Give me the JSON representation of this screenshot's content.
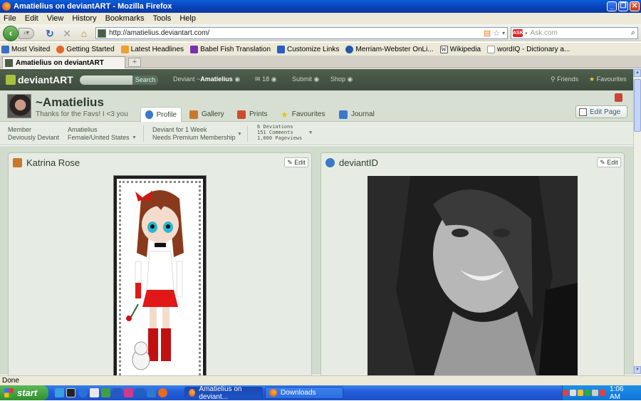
{
  "window": {
    "title": "Amatielius on deviantART - Mozilla Firefox"
  },
  "menu": [
    "File",
    "Edit",
    "View",
    "History",
    "Bookmarks",
    "Tools",
    "Help"
  ],
  "nav": {
    "url": "http://amatielius.deviantart.com/",
    "search_placeholder": "Ask.com"
  },
  "bookmarks": [
    {
      "label": "Most Visited",
      "color": "#3a6fc4"
    },
    {
      "label": "Getting Started",
      "color": "#e2682a"
    },
    {
      "label": "Latest Headlines",
      "color": "#f0a030"
    },
    {
      "label": "Babel Fish Translation",
      "color": "#7a2fb0"
    },
    {
      "label": "Customize Links",
      "color": "#2a5fc0"
    },
    {
      "label": "Merriam-Webster OnLi...",
      "color": "#2458a8"
    },
    {
      "label": "Wikipedia",
      "color": "#555555"
    },
    {
      "label": "wordIQ - Dictionary a...",
      "color": "#cccccc"
    }
  ],
  "tab": {
    "title": "Amatielius on deviantART"
  },
  "da": {
    "logo": "deviantART",
    "search_button": "Search",
    "deviant_prefix": "Deviant ~",
    "deviant_name": "Amatielius",
    "messages": "18",
    "submit": "Submit",
    "shop": "Shop",
    "friends": "Friends",
    "favourites": "Favourites"
  },
  "profile": {
    "username": "~Amatielius",
    "tagline": "Thanks for the Favs! I <3 you",
    "tabs": [
      {
        "label": "Profile",
        "color": "#3a78c9",
        "active": true
      },
      {
        "label": "Gallery",
        "color": "#c9782a",
        "active": false
      },
      {
        "label": "Prints",
        "color": "#d04a2a",
        "active": false
      },
      {
        "label": "Favourites",
        "color": "#e8c020",
        "active": false
      },
      {
        "label": "Journal",
        "color": "#3a78c9",
        "active": false
      }
    ],
    "edit_page": "Edit Page"
  },
  "info": {
    "member": "Member",
    "member_type": "Deviously Deviant",
    "name": "Amatielius",
    "location": "Female/United States",
    "duration": "Deviant for 1 Week",
    "membership": "Needs Premium Membership",
    "deviations": "6 Deviations",
    "comments": "151 Comments",
    "pageviews": "1,000 Pageviews"
  },
  "panels": {
    "left_title": "Katrina Rose",
    "right_title": "deviantID",
    "edit_label": "Edit"
  },
  "status": "Done",
  "taskbar": {
    "start": "start",
    "tasks": [
      "Amatielius on deviant...",
      "Downloads"
    ],
    "time": "1:06 AM"
  }
}
